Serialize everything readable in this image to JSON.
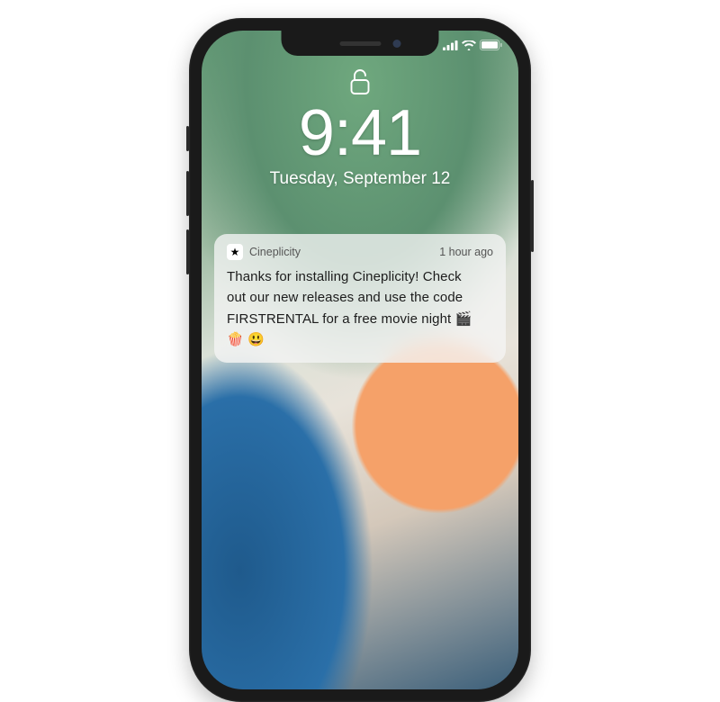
{
  "status": {
    "time": "9:41",
    "date": "Tuesday, September 12"
  },
  "notification": {
    "app_name": "Cineplicity",
    "time_ago": "1 hour ago",
    "message_line1": "Thanks for installing Cineplicity! Check",
    "message_line2": "out our new releases and use the code",
    "message_line3": "FIRSTRENTAL for a free movie night 🎬",
    "message_line4": "🍿 😃"
  }
}
